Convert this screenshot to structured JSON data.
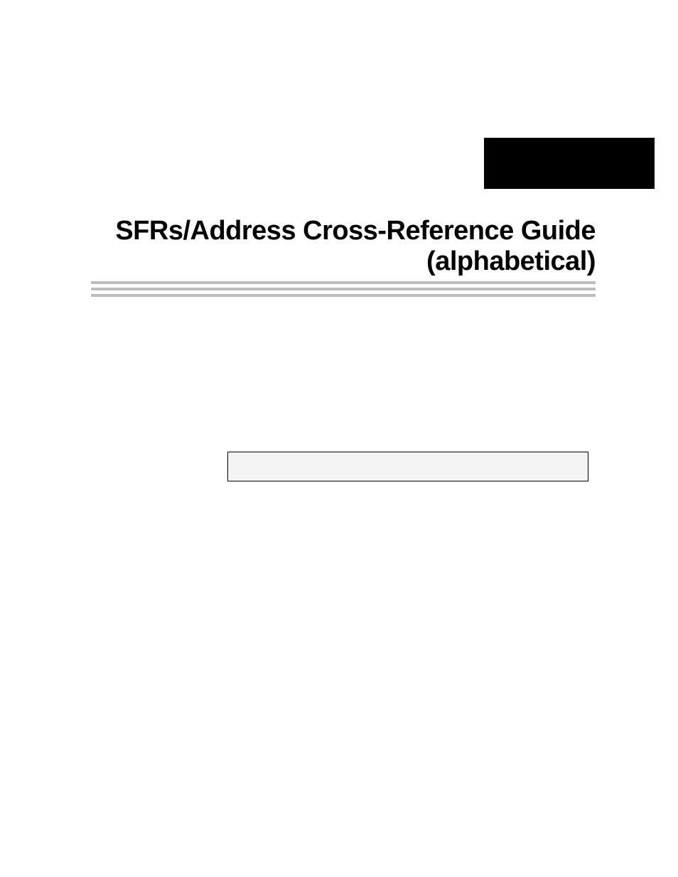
{
  "header": {
    "title_line1": "SFRs/Address Cross-Reference Guide",
    "title_line2": "(alphabetical)"
  }
}
